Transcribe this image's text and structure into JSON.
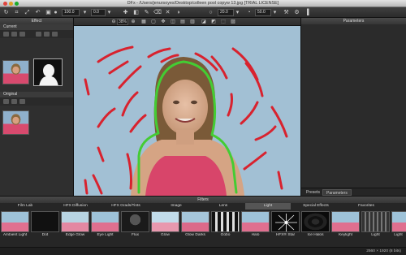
{
  "window": {
    "title": "DFx - /Users/jenursoyes/Desktop/colleen pool copyw 13.jpg [TRIAL LICENSE]"
  },
  "toolbar": {
    "brush_size": "100.0",
    "opacity": "0.0",
    "feather": "20.0",
    "strength": "50.0"
  },
  "view": {
    "zoom": "38%"
  },
  "effect_panel": {
    "title": "Effect",
    "current_label": "Current",
    "original_label": "Original"
  },
  "parameters_panel": {
    "title": "Parameters",
    "tabs": [
      "Presets",
      "Parameters"
    ],
    "active_tab": "Parameters"
  },
  "filters_panel": {
    "title": "Filters",
    "categories": [
      "Film Lab",
      "HFX Diffusion",
      "HFX Grads/Tints",
      "Image",
      "Lens",
      "Light",
      "Special Effects",
      "Favorites"
    ],
    "active_category": "Light",
    "items": [
      "Ambient Light",
      "Dot",
      "Edge Glow",
      "Eye Light",
      "Flux",
      "Glow",
      "Glow Darks",
      "Gobo",
      "Halo",
      "HFX® Star",
      "Ice Halos",
      "Keylight",
      "Light",
      "Light"
    ]
  },
  "status": {
    "dimensions": "2560 × 1920 (8 bits)"
  },
  "colors": {
    "stroke_red": "#d8222e",
    "stroke_green": "#44cc33",
    "accent_active": "#555555"
  },
  "icons": [
    "rotate-icon",
    "crop-icon",
    "undo-icon",
    "redo-icon",
    "brush-icon",
    "eraser-icon",
    "zoom-in-icon",
    "zoom-out-icon",
    "hand-icon",
    "fit-icon",
    "mask-icon",
    "prev-arrow-icon",
    "next-arrow-icon"
  ]
}
